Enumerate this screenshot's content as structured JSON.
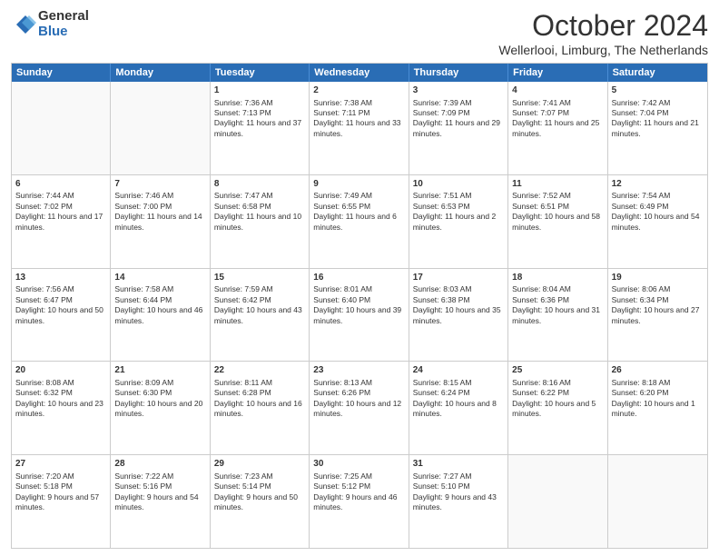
{
  "logo": {
    "general": "General",
    "blue": "Blue"
  },
  "title": "October 2024",
  "location": "Wellerlooi, Limburg, The Netherlands",
  "days_of_week": [
    "Sunday",
    "Monday",
    "Tuesday",
    "Wednesday",
    "Thursday",
    "Friday",
    "Saturday"
  ],
  "weeks": [
    [
      {
        "day": "",
        "content": ""
      },
      {
        "day": "",
        "content": ""
      },
      {
        "day": "1",
        "content": "Sunrise: 7:36 AM\nSunset: 7:13 PM\nDaylight: 11 hours and 37 minutes."
      },
      {
        "day": "2",
        "content": "Sunrise: 7:38 AM\nSunset: 7:11 PM\nDaylight: 11 hours and 33 minutes."
      },
      {
        "day": "3",
        "content": "Sunrise: 7:39 AM\nSunset: 7:09 PM\nDaylight: 11 hours and 29 minutes."
      },
      {
        "day": "4",
        "content": "Sunrise: 7:41 AM\nSunset: 7:07 PM\nDaylight: 11 hours and 25 minutes."
      },
      {
        "day": "5",
        "content": "Sunrise: 7:42 AM\nSunset: 7:04 PM\nDaylight: 11 hours and 21 minutes."
      }
    ],
    [
      {
        "day": "6",
        "content": "Sunrise: 7:44 AM\nSunset: 7:02 PM\nDaylight: 11 hours and 17 minutes."
      },
      {
        "day": "7",
        "content": "Sunrise: 7:46 AM\nSunset: 7:00 PM\nDaylight: 11 hours and 14 minutes."
      },
      {
        "day": "8",
        "content": "Sunrise: 7:47 AM\nSunset: 6:58 PM\nDaylight: 11 hours and 10 minutes."
      },
      {
        "day": "9",
        "content": "Sunrise: 7:49 AM\nSunset: 6:55 PM\nDaylight: 11 hours and 6 minutes."
      },
      {
        "day": "10",
        "content": "Sunrise: 7:51 AM\nSunset: 6:53 PM\nDaylight: 11 hours and 2 minutes."
      },
      {
        "day": "11",
        "content": "Sunrise: 7:52 AM\nSunset: 6:51 PM\nDaylight: 10 hours and 58 minutes."
      },
      {
        "day": "12",
        "content": "Sunrise: 7:54 AM\nSunset: 6:49 PM\nDaylight: 10 hours and 54 minutes."
      }
    ],
    [
      {
        "day": "13",
        "content": "Sunrise: 7:56 AM\nSunset: 6:47 PM\nDaylight: 10 hours and 50 minutes."
      },
      {
        "day": "14",
        "content": "Sunrise: 7:58 AM\nSunset: 6:44 PM\nDaylight: 10 hours and 46 minutes."
      },
      {
        "day": "15",
        "content": "Sunrise: 7:59 AM\nSunset: 6:42 PM\nDaylight: 10 hours and 43 minutes."
      },
      {
        "day": "16",
        "content": "Sunrise: 8:01 AM\nSunset: 6:40 PM\nDaylight: 10 hours and 39 minutes."
      },
      {
        "day": "17",
        "content": "Sunrise: 8:03 AM\nSunset: 6:38 PM\nDaylight: 10 hours and 35 minutes."
      },
      {
        "day": "18",
        "content": "Sunrise: 8:04 AM\nSunset: 6:36 PM\nDaylight: 10 hours and 31 minutes."
      },
      {
        "day": "19",
        "content": "Sunrise: 8:06 AM\nSunset: 6:34 PM\nDaylight: 10 hours and 27 minutes."
      }
    ],
    [
      {
        "day": "20",
        "content": "Sunrise: 8:08 AM\nSunset: 6:32 PM\nDaylight: 10 hours and 23 minutes."
      },
      {
        "day": "21",
        "content": "Sunrise: 8:09 AM\nSunset: 6:30 PM\nDaylight: 10 hours and 20 minutes."
      },
      {
        "day": "22",
        "content": "Sunrise: 8:11 AM\nSunset: 6:28 PM\nDaylight: 10 hours and 16 minutes."
      },
      {
        "day": "23",
        "content": "Sunrise: 8:13 AM\nSunset: 6:26 PM\nDaylight: 10 hours and 12 minutes."
      },
      {
        "day": "24",
        "content": "Sunrise: 8:15 AM\nSunset: 6:24 PM\nDaylight: 10 hours and 8 minutes."
      },
      {
        "day": "25",
        "content": "Sunrise: 8:16 AM\nSunset: 6:22 PM\nDaylight: 10 hours and 5 minutes."
      },
      {
        "day": "26",
        "content": "Sunrise: 8:18 AM\nSunset: 6:20 PM\nDaylight: 10 hours and 1 minute."
      }
    ],
    [
      {
        "day": "27",
        "content": "Sunrise: 7:20 AM\nSunset: 5:18 PM\nDaylight: 9 hours and 57 minutes."
      },
      {
        "day": "28",
        "content": "Sunrise: 7:22 AM\nSunset: 5:16 PM\nDaylight: 9 hours and 54 minutes."
      },
      {
        "day": "29",
        "content": "Sunrise: 7:23 AM\nSunset: 5:14 PM\nDaylight: 9 hours and 50 minutes."
      },
      {
        "day": "30",
        "content": "Sunrise: 7:25 AM\nSunset: 5:12 PM\nDaylight: 9 hours and 46 minutes."
      },
      {
        "day": "31",
        "content": "Sunrise: 7:27 AM\nSunset: 5:10 PM\nDaylight: 9 hours and 43 minutes."
      },
      {
        "day": "",
        "content": ""
      },
      {
        "day": "",
        "content": ""
      }
    ]
  ]
}
